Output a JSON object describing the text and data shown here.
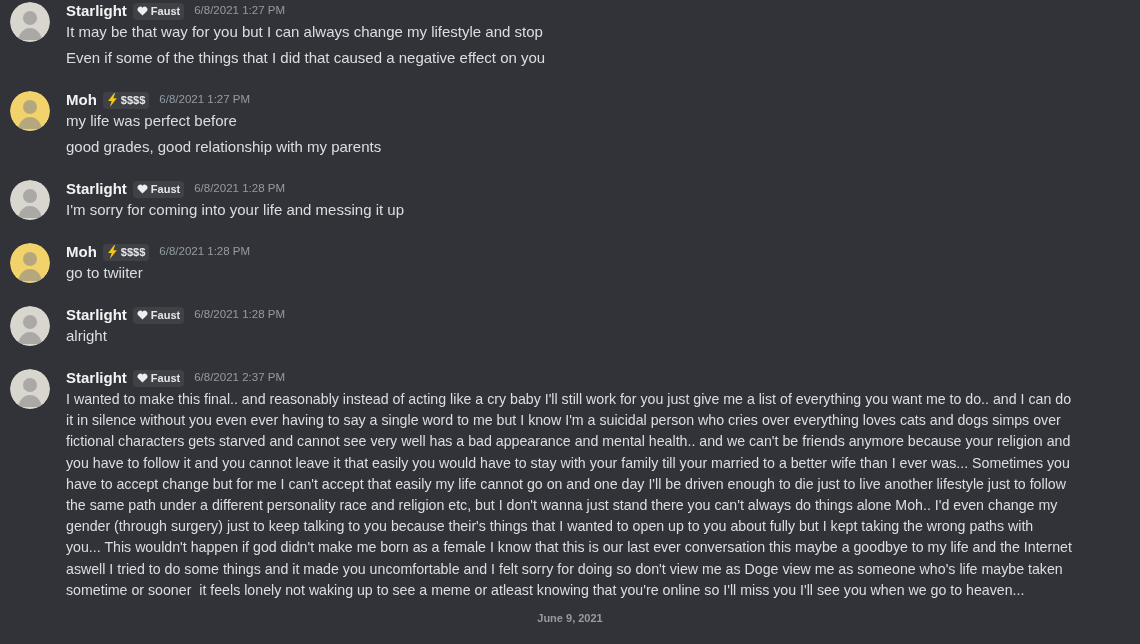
{
  "messages": [
    {
      "author": "Starlight",
      "avatar": {
        "color": "#d9d6d0"
      },
      "tag": {
        "kind": "heart",
        "label": "Faust"
      },
      "timestamp": "6/8/2021 1:27 PM",
      "lines": [
        "It may be that way for you but I can always change my lifestyle and stop",
        "Even if some of the things that I did that caused a negative effect on you"
      ],
      "kind": "separate"
    },
    {
      "author": "Moh",
      "avatar": {
        "color": "#f2d36b"
      },
      "tag": {
        "kind": "bolt",
        "label": "$$$$"
      },
      "timestamp": "6/8/2021 1:27 PM",
      "lines": [
        "my life was perfect before",
        "good grades, good relationship with my parents"
      ],
      "kind": "separate"
    },
    {
      "author": "Starlight",
      "avatar": {
        "color": "#d9d6d0"
      },
      "tag": {
        "kind": "heart",
        "label": "Faust"
      },
      "timestamp": "6/8/2021 1:28 PM",
      "lines": [
        "I'm sorry for coming into your life and messing it up"
      ],
      "kind": "separate"
    },
    {
      "author": "Moh",
      "avatar": {
        "color": "#f2d36b"
      },
      "tag": {
        "kind": "bolt",
        "label": "$$$$"
      },
      "timestamp": "6/8/2021 1:28 PM",
      "lines": [
        "go to twiiter"
      ],
      "kind": "separate"
    },
    {
      "author": "Starlight",
      "avatar": {
        "color": "#d9d6d0"
      },
      "tag": {
        "kind": "heart",
        "label": "Faust"
      },
      "timestamp": "6/8/2021 1:28 PM",
      "lines": [
        "alright"
      ],
      "kind": "separate"
    },
    {
      "author": "Starlight",
      "avatar": {
        "color": "#d9d6d0"
      },
      "tag": {
        "kind": "heart",
        "label": "Faust"
      },
      "timestamp": "6/8/2021 2:37 PM",
      "kind": "wrapped",
      "lines": [
        "I wanted to make this final.. and reasonably instead of acting like a cry baby I'll still work for you just give me a list of everything you want me to do.. and I can do",
        "it in silence without you even ever having to say a single word to me but I know I'm a suicidal person who cries over everything loves cats and dogs simps over",
        "fictional characters gets starved and cannot see very well has a bad appearance and mental health.. and we can't be friends anymore because your religion and",
        "you have to follow it and you cannot leave it that easily you would have to stay with your family till your married to a better wife than I ever was... Sometimes you",
        "have to accept change but for me I can't accept that easily my life cannot go on and one day I'll be driven enough to die just to live another lifestyle just to follow",
        "the same path under a different personality race and religion etc, but I don't wanna just stand there you can't always do things alone Moh.. I'd even change my",
        "gender (through surgery) just to keep talking to you because their's things that I wanted to open up to you about fully but I kept taking the wrong paths with",
        "you... This wouldn't happen if god didn't make me born as a female I know that this is our last ever conversation this maybe a goodbye to my life and the Internet",
        "aswell I tried to do some things and it made you uncomfortable and I felt sorry for doing so don't view me as Doge view me as someone who's life maybe taken",
        "sometime or sooner  it feels lonely not waking up to see a meme or atleast knowing that you're online so I'll miss you I'll see you when we go to heaven..."
      ]
    }
  ],
  "date_divider": "June 9, 2021"
}
